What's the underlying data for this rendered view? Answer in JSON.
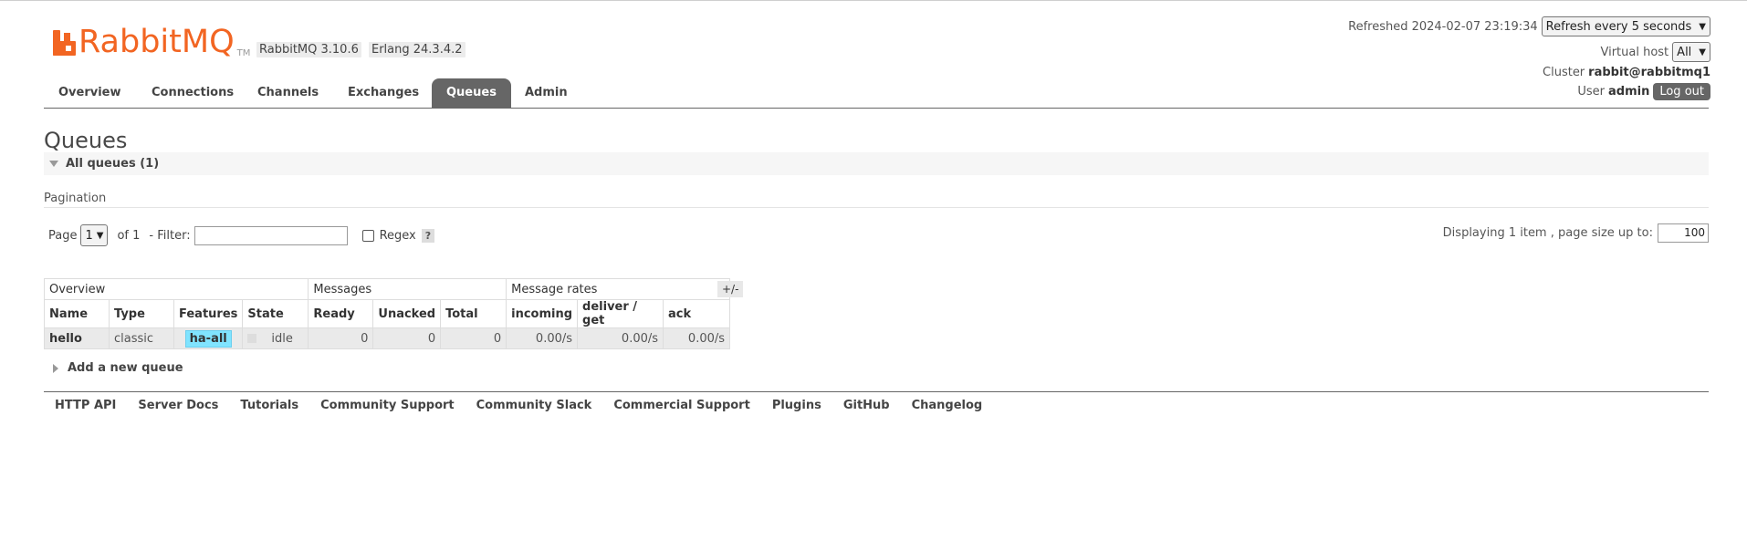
{
  "app": {
    "logo_text": "RabbitMQ",
    "logo_tm": "TM",
    "version": "RabbitMQ 3.10.6",
    "erlang": "Erlang 24.3.4.2"
  },
  "status": {
    "refreshed": "Refreshed 2024-02-07 23:19:34",
    "refresh_option": "Refresh every 5 seconds",
    "vhost_label": "Virtual host",
    "vhost_value": "All",
    "cluster_label": "Cluster",
    "cluster_value": "rabbit@rabbitmq1",
    "user_label": "User",
    "user_value": "admin",
    "logout": "Log out"
  },
  "tabs": [
    "Overview",
    "Connections",
    "Channels",
    "Exchanges",
    "Queues",
    "Admin"
  ],
  "active_tab": "Queues",
  "page": {
    "title": "Queues",
    "section": "All queues (1)",
    "pagination_label": "Pagination",
    "page_label": "Page",
    "page_value": "1",
    "of_label": "of 1",
    "filter_label": "- Filter:",
    "regex_label": "Regex",
    "help": "?",
    "display_info": "Displaying 1 item , page size up to:",
    "page_size": "100"
  },
  "table": {
    "groups": [
      "Overview",
      "Messages",
      "Message rates"
    ],
    "toggle": "+/-",
    "columns": [
      "Name",
      "Type",
      "Features",
      "State",
      "Ready",
      "Unacked",
      "Total",
      "incoming",
      "deliver / get",
      "ack"
    ],
    "rows": [
      {
        "name": "hello",
        "type": "classic",
        "features": "ha-all",
        "state": "idle",
        "ready": "0",
        "unacked": "0",
        "total": "0",
        "incoming": "0.00/s",
        "deliver_get": "0.00/s",
        "ack": "0.00/s"
      }
    ]
  },
  "add_queue": "Add a new queue",
  "footer": [
    "HTTP API",
    "Server Docs",
    "Tutorials",
    "Community Support",
    "Community Slack",
    "Commercial Support",
    "Plugins",
    "GitHub",
    "Changelog"
  ]
}
